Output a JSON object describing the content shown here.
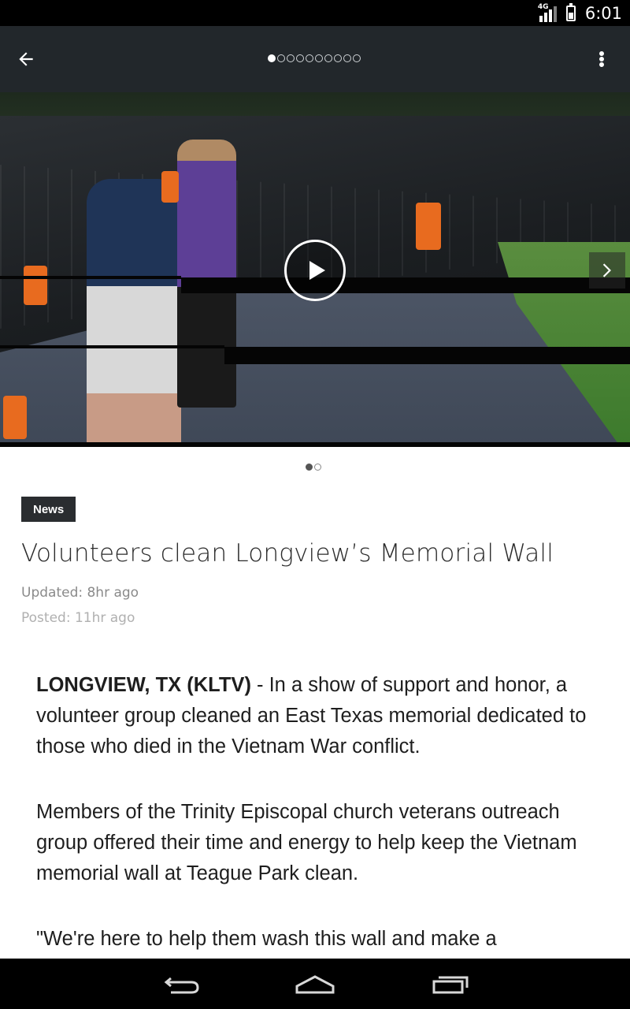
{
  "status_bar": {
    "network": "4G",
    "time": "6:01"
  },
  "app_bar": {
    "page_count": 10,
    "active_page": 1
  },
  "video": {
    "play_label": "Play video",
    "slide_count": 2,
    "active_slide": 1
  },
  "article": {
    "category": "News",
    "headline": "Volunteers clean Longview’s Memorial Wall",
    "updated": "Updated: 8hr ago",
    "posted": "Posted: 11hr ago",
    "dateline": "LONGVIEW, TX (KLTV)",
    "p1_rest": " - In a show of support and honor, a volunteer group cleaned an East Texas memorial dedicated to those who died in the Vietnam War conflict.",
    "p2": "Members of the Trinity Episcopal church veterans outreach group offered their time and energy to help keep the Vietnam memorial wall at Teague Park clean.",
    "p3": "\"We're here to help them wash this wall and make a"
  },
  "icons": {
    "back": "arrow-left-icon",
    "more": "more-vert-icon",
    "play": "play-icon",
    "next": "chevron-right-icon",
    "nav_back": "nav-back-icon",
    "nav_home": "nav-home-icon",
    "nav_recents": "nav-recents-icon"
  },
  "colors": {
    "app_bar": "#22272b",
    "badge": "#2a2d30",
    "text": "#1e1e1e"
  }
}
